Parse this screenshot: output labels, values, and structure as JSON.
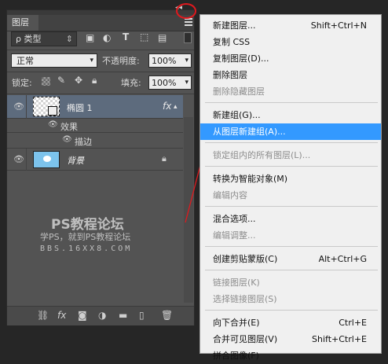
{
  "panel": {
    "tab_label": "图层",
    "collapse_glyph": "◂◂",
    "close_glyph": "✕",
    "filter": {
      "kind_label": "ρ 类型",
      "kind_glyph": "⇕"
    },
    "filter_icons": [
      "image-icon",
      "adjust-icon",
      "type-icon",
      "shape-icon",
      "smartobject-icon"
    ],
    "blend_mode": "正常",
    "opacity_label": "不透明度:",
    "opacity_value": "100%",
    "lock_label": "锁定:",
    "fill_label": "填充:",
    "fill_value": "100%",
    "layers": [
      {
        "name": "椭圆 1",
        "fx": "fx"
      },
      {
        "name": "效果"
      },
      {
        "name": "描边"
      },
      {
        "name": "背景"
      }
    ],
    "watermark": {
      "line1": "PS教程论坛",
      "line2": "学PS，就到PS教程论坛",
      "line3": "BBS.16XX8.COM"
    }
  },
  "menu": {
    "items": [
      {
        "label": "新建图层...",
        "shortcut": "Shift+Ctrl+N",
        "state": "normal"
      },
      {
        "label": "复制 CSS",
        "shortcut": "",
        "state": "normal"
      },
      {
        "label": "复制图层(D)...",
        "shortcut": "",
        "state": "normal"
      },
      {
        "label": "删除图层",
        "shortcut": "",
        "state": "normal"
      },
      {
        "label": "删除隐藏图层",
        "shortcut": "",
        "state": "disabled"
      },
      {
        "label": "新建组(G)...",
        "shortcut": "",
        "state": "normal"
      },
      {
        "label": "从图层新建组(A)...",
        "shortcut": "",
        "state": "highlighted"
      },
      {
        "label": "锁定组内的所有图层(L)...",
        "shortcut": "",
        "state": "disabled"
      },
      {
        "label": "转换为智能对象(M)",
        "shortcut": "",
        "state": "normal"
      },
      {
        "label": "编辑内容",
        "shortcut": "",
        "state": "disabled"
      },
      {
        "label": "混合选项...",
        "shortcut": "",
        "state": "normal"
      },
      {
        "label": "编辑调整...",
        "shortcut": "",
        "state": "disabled"
      },
      {
        "label": "创建剪贴蒙版(C)",
        "shortcut": "Alt+Ctrl+G",
        "state": "normal"
      },
      {
        "label": "链接图层(K)",
        "shortcut": "",
        "state": "disabled"
      },
      {
        "label": "选择链接图层(S)",
        "shortcut": "",
        "state": "disabled"
      },
      {
        "label": "向下合并(E)",
        "shortcut": "Ctrl+E",
        "state": "normal"
      },
      {
        "label": "合并可见图层(V)",
        "shortcut": "Shift+Ctrl+E",
        "state": "normal"
      },
      {
        "label": "拼合图像(F)",
        "shortcut": "",
        "state": "normal"
      }
    ]
  },
  "colors": {
    "highlight": "#3399ff",
    "annotation": "#e0191e",
    "panel_bg": "#535353",
    "selected_layer": "#5d6b7d"
  }
}
